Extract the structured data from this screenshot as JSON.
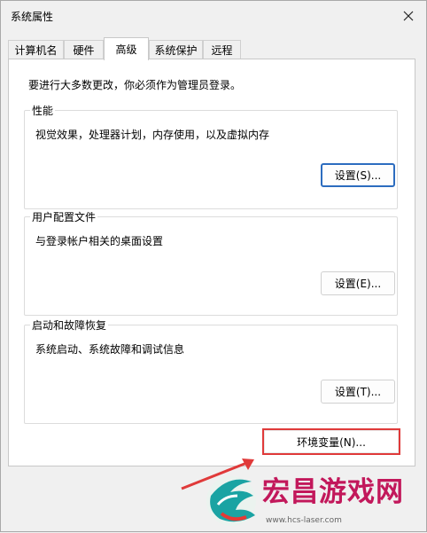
{
  "window": {
    "title": "系统属性"
  },
  "tabs": [
    {
      "label": "计算机名",
      "active": false
    },
    {
      "label": "硬件",
      "active": false
    },
    {
      "label": "高级",
      "active": true
    },
    {
      "label": "系统保护",
      "active": false
    },
    {
      "label": "远程",
      "active": false
    }
  ],
  "panel": {
    "intro": "要进行大多数更改，你必须作为管理员登录。",
    "performance": {
      "title": "性能",
      "desc": "视觉效果，处理器计划，内存使用，以及虚拟内存",
      "button": "设置(S)..."
    },
    "user_profiles": {
      "title": "用户配置文件",
      "desc": "与登录帐户相关的桌面设置",
      "button": "设置(E)..."
    },
    "startup_recovery": {
      "title": "启动和故障恢复",
      "desc": "系统启动、系统故障和调试信息",
      "button": "设置(T)..."
    }
  },
  "env_button": "环境变量(N)...",
  "watermark": {
    "text": "宏昌游戏网",
    "url": "www.hcs-laser.com"
  },
  "colors": {
    "highlight": "#e03a3a",
    "focus": "#2c6cbf",
    "watermark": "#c2185b"
  },
  "icons": {
    "close": "close-icon",
    "arrow": "arrow-icon",
    "logo": "logo-icon"
  }
}
